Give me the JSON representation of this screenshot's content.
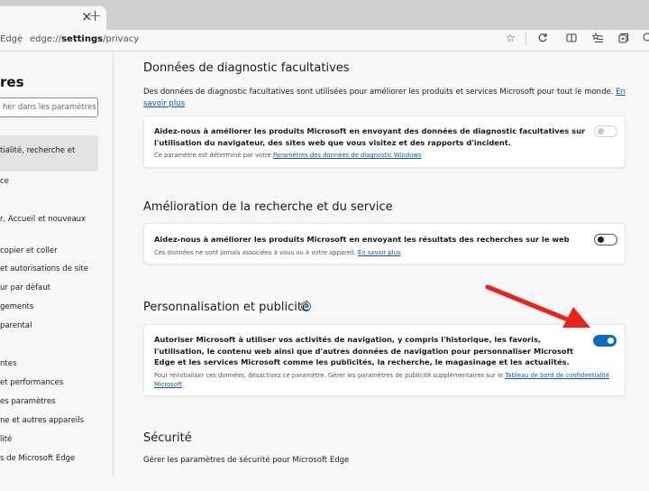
{
  "tab": {
    "close": "×",
    "new_tab": "+"
  },
  "address_bar": {
    "browser_label": "Edge",
    "separator": "|",
    "url_prefix": "edge://",
    "url_bold": "settings",
    "url_rest": "/privacy"
  },
  "toolbar_icons": [
    "star-icon",
    "refresh-icon",
    "split-screen-icon",
    "favorites-icon",
    "collections-icon",
    "extensions-icon"
  ],
  "sidebar": {
    "title": "res",
    "search_placeholder": "her dans les paramètres",
    "items": [
      {
        "label": "tialité, recherche et"
      },
      {
        "label": "ce"
      },
      {
        "label": "r, Accueil et nouveaux"
      },
      {
        "label": " copier et coller"
      },
      {
        "label": "et autorisations de site"
      },
      {
        "label": "ur par défaut"
      },
      {
        "label": "gements"
      },
      {
        "label": " parental"
      },
      {
        "label": "ntes"
      },
      {
        "label": "et performances"
      },
      {
        "label": "es paramètres"
      },
      {
        "label": "ne et autres appareils"
      },
      {
        "label": "lité"
      },
      {
        "label": "s de Microsoft Edge"
      }
    ]
  },
  "sections": {
    "diagnostic": {
      "title": "Données de diagnostic facultatives",
      "description": "Des données de diagnostic facultatives sont utilisées pour améliorer les produits et services Microsoft pour tout le monde.",
      "link": "En savoir plus",
      "card": {
        "main": "Aidez-nous à améliorer les produits Microsoft en envoyant des données de diagnostic facultatives sur l'utilisation du navigateur, des sites web que vous visitez et des rapports d'incident.",
        "sub": "Ce paramètre est déterminé par votre",
        "sub_link": "Paramètres des données de diagnostic Windows",
        "toggle_state": "disabled"
      }
    },
    "search": {
      "title": "Amélioration de la recherche et du service",
      "card": {
        "main": "Aidez-nous à améliorer les produits Microsoft en envoyant les résultats des recherches sur le web",
        "sub": "Ces données ne sont jamais associées à vous ou à votre appareil.",
        "sub_link": "En savoir plus",
        "toggle_state": "off"
      }
    },
    "personalization": {
      "title": "Personnalisation et publicité",
      "card": {
        "main": "Autoriser Microsoft à utiliser vos activités de navigation, y compris l'historique, les favoris, l'utilisation, le contenu web ainsi que d'autres données de navigation pour personnaliser Microsoft Edge et les services Microsoft comme les publicités, la recherche, le magasinage et les actualités.",
        "sub": "Pour réinitialiser ces données, désactivez ce paramètre. Gérer les paramètres de publicité supplémentaires sur le",
        "sub_link": "Tableau de bord de confidentialité Microsoft",
        "toggle_state": "on"
      }
    },
    "security": {
      "title": "Sécurité",
      "description": "Gérer les paramètres de sécurité pour Microsoft Edge"
    }
  },
  "colors": {
    "accent": "#0f6cbd",
    "annotation_arrow": "#e8231c"
  }
}
